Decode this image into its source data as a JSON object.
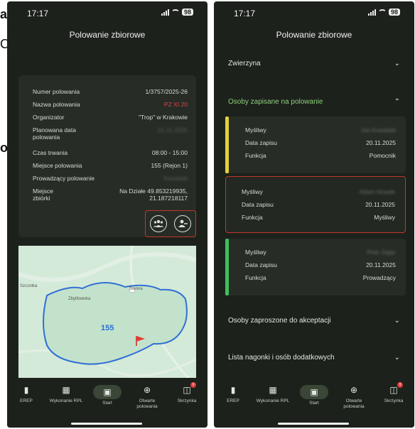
{
  "left_phone": {
    "status": {
      "time": "17:17",
      "battery": "98"
    },
    "title": "Polowanie zbiorowe",
    "info": [
      {
        "key": "Numer polowania",
        "value": "1/3757/2025-26",
        "style": "normal"
      },
      {
        "key": "Nazwa polowania",
        "value": "PZ XI 20",
        "style": "red"
      },
      {
        "key": "Organizator",
        "value": "\"Trop\" w Krakowie",
        "style": "normal"
      },
      {
        "key": "Planowana data polowania",
        "value": "21.11.2025",
        "style": "blur"
      },
      {
        "key": "Czas trwania",
        "value": "08:00 - 15:00",
        "style": "normal"
      },
      {
        "key": "Miejsce polowania",
        "value": "155 (Rejon 1)",
        "style": "normal"
      },
      {
        "key": "Prowadzący polowanie",
        "value": "Kowalski",
        "style": "blur"
      },
      {
        "key": "Miejsce zbiórki",
        "value": "Na Działe 49.853219935, 21.187218117",
        "style": "normal"
      }
    ],
    "map": {
      "label_left": "Szczotka",
      "label_mid": "Zbylitowska",
      "label_right": "Sienna",
      "area_number": "155"
    }
  },
  "right_phone": {
    "status": {
      "time": "17:17",
      "battery": "98"
    },
    "title": "Polowanie zbiorowe",
    "sections": {
      "zwierzyna": "Zwierzyna",
      "osoby_zapisane": "Osoby zapisane na polowanie",
      "osoby_zaproszone": "Osoby zaproszone do akceptacji",
      "lista_nagonki": "Lista nagonki i osób dodatkowych"
    },
    "hunters": [
      {
        "name_label": "Myśliwy",
        "name_value": "Jan Kowalski",
        "date_label": "Data zapisu",
        "date_value": "20.11.2025",
        "role_label": "Funkcja",
        "role_value": "Pomocnik",
        "stripe_color": "#e3cf3a"
      },
      {
        "name_label": "Myśliwy",
        "name_value": "Adam Nowak",
        "date_label": "Data zapisu",
        "date_value": "20.11.2025",
        "role_label": "Funkcja",
        "role_value": "Myśliwy",
        "stripe_color": ""
      },
      {
        "name_label": "Myśliwy",
        "name_value": "Piotr Zając",
        "date_label": "Data zapisu",
        "date_value": "20.11.2025",
        "role_label": "Funkcja",
        "role_value": "Prowadzący",
        "stripe_color": "#3fbf5a"
      }
    ]
  },
  "nav": [
    {
      "label": "EREP",
      "icon": "book-icon"
    },
    {
      "label": "Wykonanie RPL",
      "icon": "calendar-icon"
    },
    {
      "label": "Start",
      "icon": "start-icon"
    },
    {
      "label": "Otwarte polowania",
      "icon": "target-icon"
    },
    {
      "label": "Skrzynka",
      "icon": "inbox-icon",
      "badge": "9"
    }
  ],
  "side_fragments": [
    "a",
    "C",
    "o"
  ],
  "colors": {
    "background": "#1d211c",
    "card": "#272c26",
    "accent_red": "#e04545",
    "accent_green": "#8ccf7a"
  }
}
